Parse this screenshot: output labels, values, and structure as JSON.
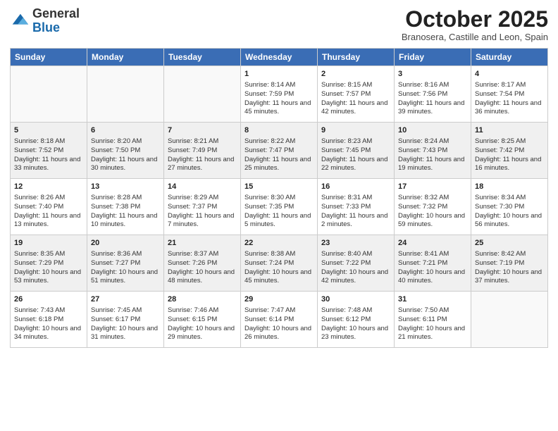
{
  "header": {
    "logo_line1": "General",
    "logo_line2": "Blue",
    "month_title": "October 2025",
    "subtitle": "Branosera, Castille and Leon, Spain"
  },
  "days_of_week": [
    "Sunday",
    "Monday",
    "Tuesday",
    "Wednesday",
    "Thursday",
    "Friday",
    "Saturday"
  ],
  "weeks": [
    [
      {
        "day": "",
        "info": ""
      },
      {
        "day": "",
        "info": ""
      },
      {
        "day": "",
        "info": ""
      },
      {
        "day": "1",
        "info": "Sunrise: 8:14 AM\nSunset: 7:59 PM\nDaylight: 11 hours and 45 minutes."
      },
      {
        "day": "2",
        "info": "Sunrise: 8:15 AM\nSunset: 7:57 PM\nDaylight: 11 hours and 42 minutes."
      },
      {
        "day": "3",
        "info": "Sunrise: 8:16 AM\nSunset: 7:56 PM\nDaylight: 11 hours and 39 minutes."
      },
      {
        "day": "4",
        "info": "Sunrise: 8:17 AM\nSunset: 7:54 PM\nDaylight: 11 hours and 36 minutes."
      }
    ],
    [
      {
        "day": "5",
        "info": "Sunrise: 8:18 AM\nSunset: 7:52 PM\nDaylight: 11 hours and 33 minutes."
      },
      {
        "day": "6",
        "info": "Sunrise: 8:20 AM\nSunset: 7:50 PM\nDaylight: 11 hours and 30 minutes."
      },
      {
        "day": "7",
        "info": "Sunrise: 8:21 AM\nSunset: 7:49 PM\nDaylight: 11 hours and 27 minutes."
      },
      {
        "day": "8",
        "info": "Sunrise: 8:22 AM\nSunset: 7:47 PM\nDaylight: 11 hours and 25 minutes."
      },
      {
        "day": "9",
        "info": "Sunrise: 8:23 AM\nSunset: 7:45 PM\nDaylight: 11 hours and 22 minutes."
      },
      {
        "day": "10",
        "info": "Sunrise: 8:24 AM\nSunset: 7:43 PM\nDaylight: 11 hours and 19 minutes."
      },
      {
        "day": "11",
        "info": "Sunrise: 8:25 AM\nSunset: 7:42 PM\nDaylight: 11 hours and 16 minutes."
      }
    ],
    [
      {
        "day": "12",
        "info": "Sunrise: 8:26 AM\nSunset: 7:40 PM\nDaylight: 11 hours and 13 minutes."
      },
      {
        "day": "13",
        "info": "Sunrise: 8:28 AM\nSunset: 7:38 PM\nDaylight: 11 hours and 10 minutes."
      },
      {
        "day": "14",
        "info": "Sunrise: 8:29 AM\nSunset: 7:37 PM\nDaylight: 11 hours and 7 minutes."
      },
      {
        "day": "15",
        "info": "Sunrise: 8:30 AM\nSunset: 7:35 PM\nDaylight: 11 hours and 5 minutes."
      },
      {
        "day": "16",
        "info": "Sunrise: 8:31 AM\nSunset: 7:33 PM\nDaylight: 11 hours and 2 minutes."
      },
      {
        "day": "17",
        "info": "Sunrise: 8:32 AM\nSunset: 7:32 PM\nDaylight: 10 hours and 59 minutes."
      },
      {
        "day": "18",
        "info": "Sunrise: 8:34 AM\nSunset: 7:30 PM\nDaylight: 10 hours and 56 minutes."
      }
    ],
    [
      {
        "day": "19",
        "info": "Sunrise: 8:35 AM\nSunset: 7:29 PM\nDaylight: 10 hours and 53 minutes."
      },
      {
        "day": "20",
        "info": "Sunrise: 8:36 AM\nSunset: 7:27 PM\nDaylight: 10 hours and 51 minutes."
      },
      {
        "day": "21",
        "info": "Sunrise: 8:37 AM\nSunset: 7:26 PM\nDaylight: 10 hours and 48 minutes."
      },
      {
        "day": "22",
        "info": "Sunrise: 8:38 AM\nSunset: 7:24 PM\nDaylight: 10 hours and 45 minutes."
      },
      {
        "day": "23",
        "info": "Sunrise: 8:40 AM\nSunset: 7:22 PM\nDaylight: 10 hours and 42 minutes."
      },
      {
        "day": "24",
        "info": "Sunrise: 8:41 AM\nSunset: 7:21 PM\nDaylight: 10 hours and 40 minutes."
      },
      {
        "day": "25",
        "info": "Sunrise: 8:42 AM\nSunset: 7:19 PM\nDaylight: 10 hours and 37 minutes."
      }
    ],
    [
      {
        "day": "26",
        "info": "Sunrise: 7:43 AM\nSunset: 6:18 PM\nDaylight: 10 hours and 34 minutes."
      },
      {
        "day": "27",
        "info": "Sunrise: 7:45 AM\nSunset: 6:17 PM\nDaylight: 10 hours and 31 minutes."
      },
      {
        "day": "28",
        "info": "Sunrise: 7:46 AM\nSunset: 6:15 PM\nDaylight: 10 hours and 29 minutes."
      },
      {
        "day": "29",
        "info": "Sunrise: 7:47 AM\nSunset: 6:14 PM\nDaylight: 10 hours and 26 minutes."
      },
      {
        "day": "30",
        "info": "Sunrise: 7:48 AM\nSunset: 6:12 PM\nDaylight: 10 hours and 23 minutes."
      },
      {
        "day": "31",
        "info": "Sunrise: 7:50 AM\nSunset: 6:11 PM\nDaylight: 10 hours and 21 minutes."
      },
      {
        "day": "",
        "info": ""
      }
    ]
  ]
}
